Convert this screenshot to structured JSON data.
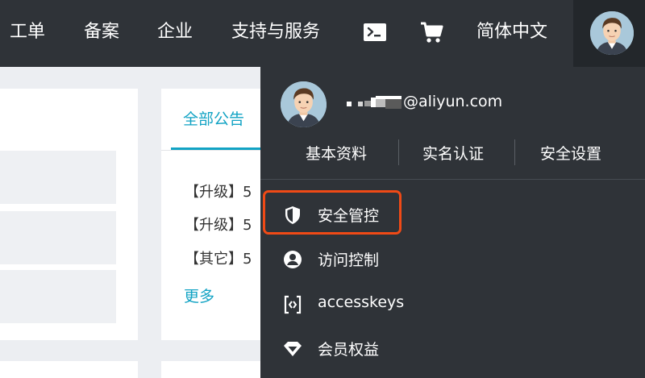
{
  "topbar": {
    "nav": [
      "工单",
      "备案",
      "企业",
      "支持与服务"
    ],
    "terminal_icon": "terminal-icon",
    "cart_icon": "cart-icon",
    "language": "简体中文",
    "avatar_icon": "user-avatar"
  },
  "notices": {
    "tab_label": "全部公告",
    "items": [
      "【升级】5",
      "【升级】5",
      "【其它】5"
    ],
    "more_label": "更多"
  },
  "user_menu": {
    "email": "@aliyun.com",
    "quick_links": [
      "基本资料",
      "实名认证",
      "安全设置"
    ],
    "items": [
      {
        "label": "安全管控",
        "icon": "shield-icon",
        "highlighted": true
      },
      {
        "label": "访问控制",
        "icon": "user-circle-icon"
      },
      {
        "label": "accesskeys",
        "icon": "code-key-icon"
      },
      {
        "label": "会员权益",
        "icon": "diamond-icon"
      }
    ]
  },
  "colors": {
    "topbar_bg": "#2f3338",
    "accent": "#12a3c4",
    "highlight_border": "#f04a16"
  }
}
